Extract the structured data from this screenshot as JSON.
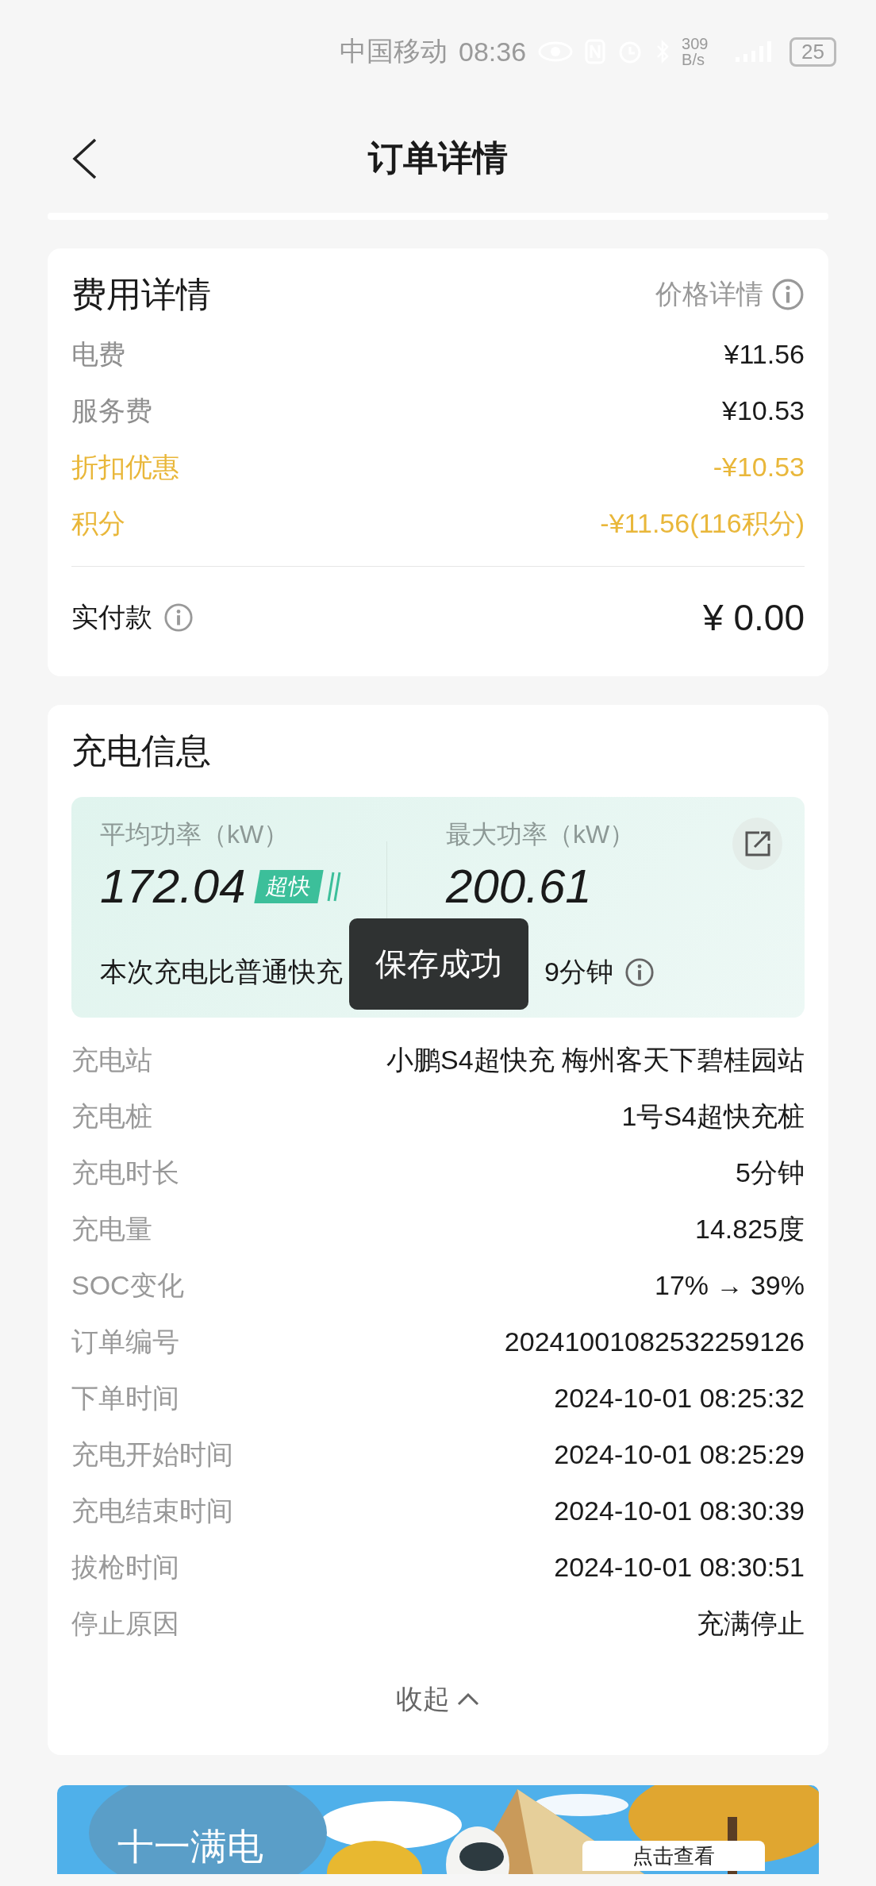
{
  "status_bar": {
    "carrier": "中国移动",
    "time": "08:36",
    "network_speed": "309 B/s",
    "battery": "25"
  },
  "header": {
    "title": "订单详情"
  },
  "fee_card": {
    "title": "费用详情",
    "price_detail_link": "价格详情",
    "items": [
      {
        "label": "电费",
        "value": "¥11.56",
        "kind": "normal"
      },
      {
        "label": "服务费",
        "value": "¥10.53",
        "kind": "normal"
      },
      {
        "label": "折扣优惠",
        "value": "-¥10.53",
        "kind": "discount"
      },
      {
        "label": "积分",
        "value": "-¥11.56(116积分)",
        "kind": "discount"
      }
    ],
    "total": {
      "label": "实付款",
      "value": "¥ 0.00"
    }
  },
  "charging_card": {
    "title": "充电信息",
    "stats": [
      {
        "label": "平均功率（kW）",
        "value": "172.04",
        "badge": "超快"
      },
      {
        "label": "最大功率（kW）",
        "value": "200.61"
      }
    ],
    "saving_note_start": "本次充电比普通快充",
    "saving_note_end": "9分钟",
    "toast": "保存成功",
    "details": [
      {
        "label": "充电站",
        "value": "小鹏S4超快充 梅州客天下碧桂园站"
      },
      {
        "label": "充电桩",
        "value": "1号S4超快充桩"
      },
      {
        "label": "充电时长",
        "value": "5分钟"
      },
      {
        "label": "充电量",
        "value": "14.825度"
      },
      {
        "label": "SOC变化",
        "value": "17% → 39%"
      },
      {
        "label": "订单编号",
        "value": "20241001082532259126"
      },
      {
        "label": "下单时间",
        "value": "2024-10-01 08:25:32"
      },
      {
        "label": "充电开始时间",
        "value": "2024-10-01 08:25:29"
      },
      {
        "label": "充电结束时间",
        "value": "2024-10-01 08:30:39"
      },
      {
        "label": "拔枪时间",
        "value": "2024-10-01 08:30:51"
      },
      {
        "label": "停止原因",
        "value": "充满停止"
      }
    ],
    "collapse_label": "收起"
  },
  "banner": {
    "title": "十一满电",
    "button": "点击查看"
  }
}
